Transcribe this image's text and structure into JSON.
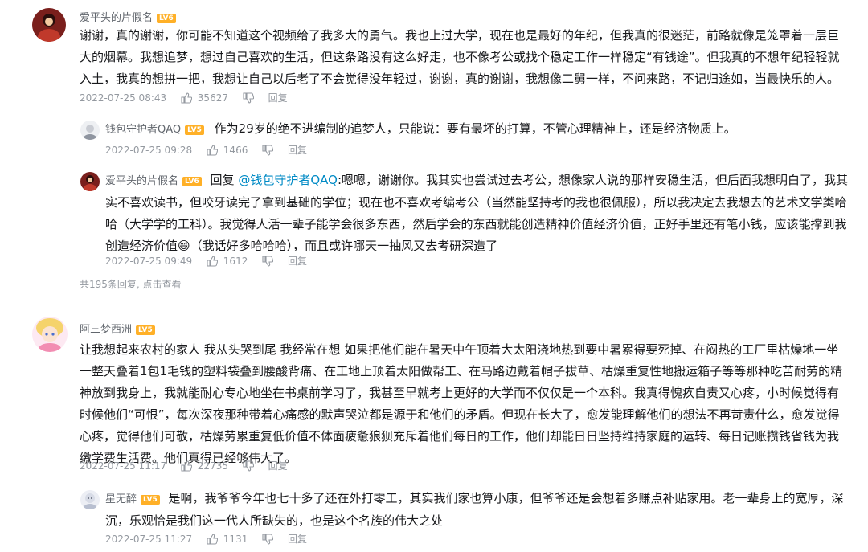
{
  "comments": [
    {
      "user": "爱平头的片假名",
      "level": "LV6",
      "text": "谢谢，真的谢谢，你可能不知道这个视频给了我多大的勇气。我也上过大学，现在也是最好的年纪，但我真的很迷茫，前路就像是笼罩着一层巨大的烟幕。我想追梦，想过自己喜欢的生活，但这条路没有这么好走，也不像考公或找个稳定工作一样稳定“有钱途”。但我真的不想年纪轻轻就入土，我真的想拼一把，我想让自己以后老了不会觉得没年轻过，谢谢，真的谢谢，我想像二舅一样，不问来路，不记归途如，当最快乐的人。",
      "time": "2022-07-25 08:43",
      "likes": "35627",
      "reply_label": "回复",
      "replies": [
        {
          "user": "钱包守护者QAQ",
          "level": "LV5",
          "text": "作为29岁的绝不进编制的追梦人，只能说：要有最坏的打算，不管心理精神上，还是经济物质上。",
          "time": "2022-07-25 09:28",
          "likes": "1466",
          "reply_label": "回复"
        },
        {
          "user": "爱平头的片假名",
          "level": "LV6",
          "reply_prefix": "回复",
          "mention": "@钱包守护者QAQ",
          "text": ":嗯嗯，谢谢你。我其实也尝试过去考公，想像家人说的那样安稳生活，但后面我想明白了，我其实不喜欢读书，但咬牙读完了拿到基础的学位；现在也不喜欢考编考公（当然能坚持考的我也很佩服），所以我决定去我想去的艺术文学类哈哈（大学学的工科）。我觉得人活一辈子能学会很多东西，然后学会的东西就能创造精神价值经济价值，正好手里还有笔小钱，应该能撑到我创造经济价值😄（我话好多哈哈哈），而且或许哪天一抽风又去考研深造了",
          "time": "2022-07-25 09:49",
          "likes": "1612",
          "reply_label": "回复"
        }
      ],
      "more_replies": "共195条回复, 点击查看"
    },
    {
      "user": "阿三梦西洲",
      "level": "LV5",
      "text": "让我想起来农村的家人 我从头哭到尾 我经常在想 如果把他们能在暑天中午顶着大太阳浇地热到要中暑累得要死掉、在闷热的工厂里枯燥地一坐一整天叠着1包1毛钱的塑料袋叠到腰酸背痛、在工地上顶着太阳做帮工、在马路边戴着帽子拔草、枯燥重复性地搬运箱子等等那种吃苦耐劳的精神放到我身上，我就能耐心专心地坐在书桌前学习了，我甚至早就考上更好的大学而不仅仅是一个本科。我真得愧疚自责又心疼，小时候觉得有时候他们“可恨”，每次深夜那种带着心痛感的默声哭泣都是源于和他们的矛盾。但现在长大了，愈发能理解他们的想法不再苛责什么，愈发觉得心疼，觉得他们可敬，枯燥劳累重复低价值不体面疲惫狼狈充斥着他们每日的工作，他们却能日日坚持维持家庭的运转、每日记账攒钱省钱为我缴学费生活费。他们真得已经够伟大了。",
      "time": "2022-07-25 11:17",
      "likes": "22735",
      "reply_label": "回复",
      "replies": [
        {
          "user": "星无醉",
          "level": "LV5",
          "text": "是啊，我爷爷今年也七十多了还在外打零工，其实我们家也算小康，但爷爷还是会想着多赚点补贴家用。老一辈身上的宽厚，深沉，乐观恰是我们这一代人所缺失的，也是这个名族的伟大之处",
          "time": "2022-07-25 11:27",
          "likes": "1131",
          "reply_label": "回复"
        }
      ]
    }
  ],
  "colors": {
    "level_badge": "#ffb027",
    "mention": "#008ac5",
    "meta": "#9499a0"
  }
}
